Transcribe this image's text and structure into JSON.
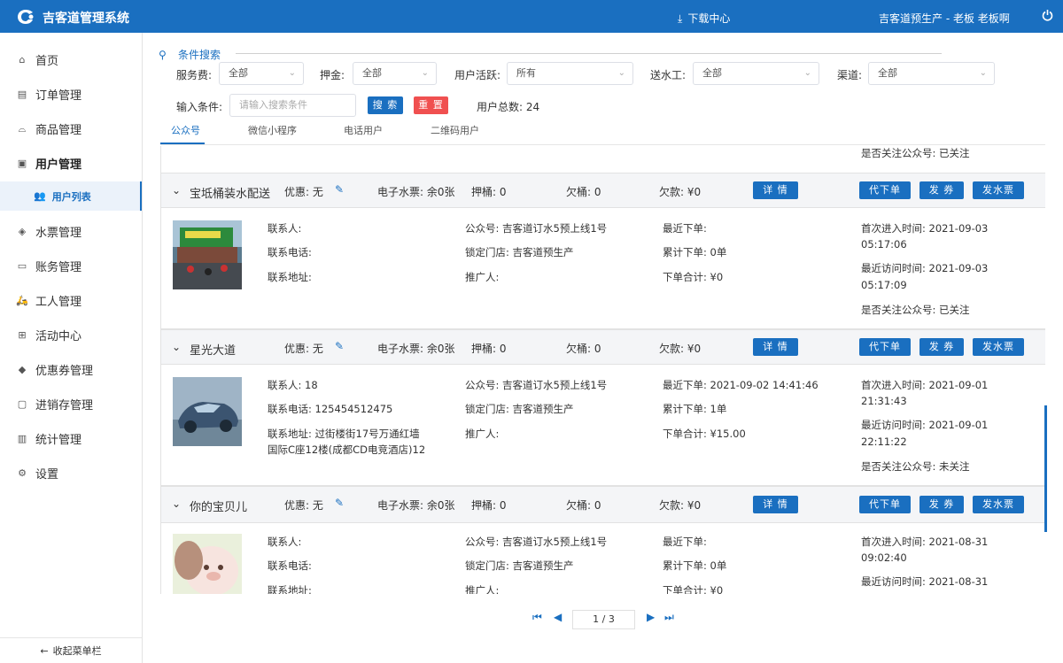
{
  "header": {
    "app_title": "吉客道管理系统",
    "download_label": "下载中心",
    "user_info": "吉客道预生产 - 老板   老板啊",
    "brand_color": "#1a6fc0"
  },
  "sidebar": {
    "items": [
      {
        "label": "首页",
        "icon": "home-icon"
      },
      {
        "label": "订单管理",
        "icon": "order-icon"
      },
      {
        "label": "商品管理",
        "icon": "basket-icon"
      },
      {
        "label": "用户管理",
        "icon": "user-card-icon"
      },
      {
        "label": "水票管理",
        "icon": "ticket-icon"
      },
      {
        "label": "账务管理",
        "icon": "money-icon"
      },
      {
        "label": "工人管理",
        "icon": "scooter-icon"
      },
      {
        "label": "活动中心",
        "icon": "gift-icon"
      },
      {
        "label": "优惠券管理",
        "icon": "coupon-icon"
      },
      {
        "label": "进销存管理",
        "icon": "inventory-icon"
      },
      {
        "label": "统计管理",
        "icon": "chart-icon"
      },
      {
        "label": "设置",
        "icon": "gear-icon"
      }
    ],
    "sub_item": {
      "label": "用户列表",
      "icon": "users-icon"
    },
    "collapse_label": "收起菜单栏"
  },
  "filters": {
    "section_title": "条件搜索",
    "service_fee": {
      "label": "服务费:",
      "value": "全部"
    },
    "deposit": {
      "label": "押金:",
      "value": "全部"
    },
    "activity": {
      "label": "用户活跃:",
      "value": "所有"
    },
    "worker": {
      "label": "送水工:",
      "value": "全部"
    },
    "channel": {
      "label": "渠道:",
      "value": "全部"
    },
    "condition": {
      "label": "输入条件:",
      "placeholder": "请输入搜索条件"
    },
    "search_btn": "搜 索",
    "reset_btn": "重 置",
    "total_label": "用户总数:  24"
  },
  "tabs": [
    "公众号",
    "微信小程序",
    "电话用户",
    "二维码用户"
  ],
  "partial_top": {
    "follow": "是否关注公众号:  已关注"
  },
  "labels": {
    "discount": "优惠:  无",
    "e_ticket": "电子水票:  余0张",
    "deposit_barrel": "押桶:  0",
    "owed_barrel": "欠桶:  0",
    "debt": "欠款:  ¥0",
    "detail_btn": "详 情",
    "order_btn": "代下单",
    "coupon_btn": "发 券",
    "ticket_btn": "发水票"
  },
  "records": [
    {
      "name": "宝坻桶装水配送",
      "contact": "联系人:",
      "phone": "联系电话:",
      "address": "联系地址:",
      "address2": "",
      "account": "公众号:  吉客道订水5预上线1号",
      "store": "锁定门店:  吉客道预生产",
      "promoter": "推广人:",
      "last_order": "最近下单:",
      "total_orders": "累计下单:  0单",
      "order_sum": "下单合计:  ¥0",
      "first_visit": "首次进入时间:  2021-09-03",
      "first_visit_time": "05:17:06",
      "last_visit": "最近访问时间:  2021-09-03",
      "last_visit_time": "05:17:09",
      "follow": "是否关注公众号:  已关注"
    },
    {
      "name": "星光大道",
      "contact": "联系人:  18",
      "phone": "联系电话:  125454512475",
      "address": "联系地址:  过街楼街17号万通红墙",
      "address2": "国际C座12楼(成都CD电竞酒店)12",
      "account": "公众号:  吉客道订水5预上线1号",
      "store": "锁定门店:  吉客道预生产",
      "promoter": "推广人:",
      "last_order": "最近下单:  2021-09-02 14:41:46",
      "total_orders": "累计下单:  1单",
      "order_sum": "下单合计:  ¥15.00",
      "first_visit": "首次进入时间:  2021-09-01",
      "first_visit_time": "21:31:43",
      "last_visit": "最近访问时间:  2021-09-01",
      "last_visit_time": "22:11:22",
      "follow": "是否关注公众号:  未关注"
    },
    {
      "name": "你的宝贝儿",
      "contact": "联系人:",
      "phone": "联系电话:",
      "address": "联系地址:",
      "address2": "",
      "account": "公众号:  吉客道订水5预上线1号",
      "store": "锁定门店:  吉客道预生产",
      "promoter": "推广人:",
      "last_order": "最近下单:",
      "total_orders": "累计下单:  0单",
      "order_sum": "下单合计:  ¥0",
      "first_visit": "首次进入时间:  2021-08-31",
      "first_visit_time": "09:02:40",
      "last_visit": "最近访问时间:  2021-08-31",
      "last_visit_time": "",
      "follow": ""
    }
  ],
  "pagination": {
    "page": "1 / 3"
  }
}
